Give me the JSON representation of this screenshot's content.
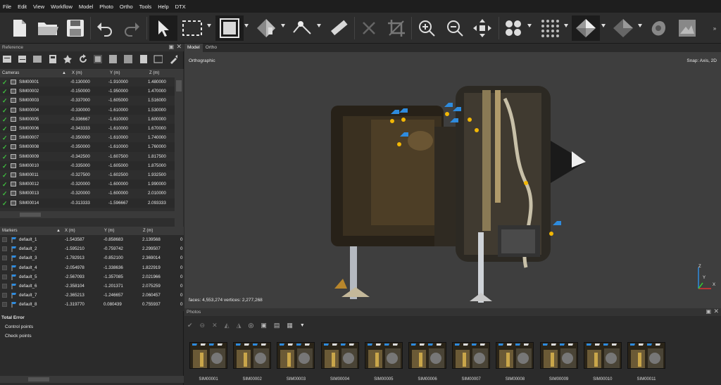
{
  "menu": [
    "File",
    "Edit",
    "View",
    "Workflow",
    "Model",
    "Photo",
    "Ortho",
    "Tools",
    "Help",
    "DTX"
  ],
  "panels": {
    "reference": "Reference",
    "photos": "Photos"
  },
  "cameras": {
    "headers": [
      "Cameras",
      "X (m)",
      "Y (m)",
      "Z (m)"
    ],
    "rows": [
      [
        "SIM00001",
        "-0.130000",
        "-1.910000",
        "1.480000"
      ],
      [
        "SIM00002",
        "-0.150000",
        "-1.950000",
        "1.470000"
      ],
      [
        "SIM00003",
        "-0.337000",
        "-1.605000",
        "1.516000"
      ],
      [
        "SIM00004",
        "-0.330000",
        "-1.610000",
        "1.530000"
      ],
      [
        "SIM00005",
        "-0.336667",
        "-1.610000",
        "1.600000"
      ],
      [
        "SIM00006",
        "-0.343333",
        "-1.610000",
        "1.670000"
      ],
      [
        "SIM00007",
        "-0.350000",
        "-1.610000",
        "1.740000"
      ],
      [
        "SIM00008",
        "-0.350000",
        "-1.610000",
        "1.760000"
      ],
      [
        "SIM00009",
        "-0.342500",
        "-1.607500",
        "1.817500"
      ],
      [
        "SIM00010",
        "-0.335000",
        "-1.605000",
        "1.875000"
      ],
      [
        "SIM00011",
        "-0.327500",
        "-1.602500",
        "1.932500"
      ],
      [
        "SIM00012",
        "-0.320000",
        "-1.600000",
        "1.990000"
      ],
      [
        "SIM00013",
        "-0.320000",
        "-1.600000",
        "2.010000"
      ],
      [
        "SIM00014",
        "-0.313333",
        "-1.596667",
        "2.093333"
      ]
    ]
  },
  "markers": {
    "headers": [
      "Markers",
      "X (m)",
      "Y (m)",
      "Z (m)"
    ],
    "rows": [
      [
        "default_1",
        "-1.543587",
        "-0.858683",
        "2.139568",
        "0"
      ],
      [
        "default_2",
        "-1.595210",
        "-0.759742",
        "2.299507",
        "0"
      ],
      [
        "default_3",
        "-1.782913",
        "-0.852100",
        "2.369014",
        "0"
      ],
      [
        "default_4",
        "-2.054978",
        "-1.338636",
        "1.822919",
        "0"
      ],
      [
        "default_5",
        "-2.567093",
        "-1.357085",
        "2.021966",
        "0"
      ],
      [
        "default_6",
        "-2.358104",
        "-1.201371",
        "2.075259",
        "0"
      ],
      [
        "default_7",
        "-2.365213",
        "-1.246657",
        "2.060457",
        "0"
      ],
      [
        "default_8",
        "-1.319770",
        "0.080439",
        "0.755937",
        "0"
      ]
    ]
  },
  "errors": {
    "total": "Total Error",
    "control": "Control points",
    "check": "Check points"
  },
  "viewport": {
    "tab_model": "Model",
    "tab_ortho": "Ortho",
    "projection": "Orthographic",
    "snap": "Snap: Axis, 2D",
    "stats": "faces: 4,553,274 vertices: 2,277,268",
    "axis_z": "Z",
    "axis_y": "Y",
    "axis_x": "X"
  },
  "thumbnails": [
    "SIM00001",
    "SIM00002",
    "SIM00003",
    "SIM00004",
    "SIM00005",
    "SIM00006",
    "SIM00007",
    "SIM00008",
    "SIM00009",
    "SIM00010",
    "SIM00011"
  ],
  "colors": {
    "accent": "#2e8bde",
    "check": "#3fbf3f",
    "marker": "#f2b705"
  }
}
